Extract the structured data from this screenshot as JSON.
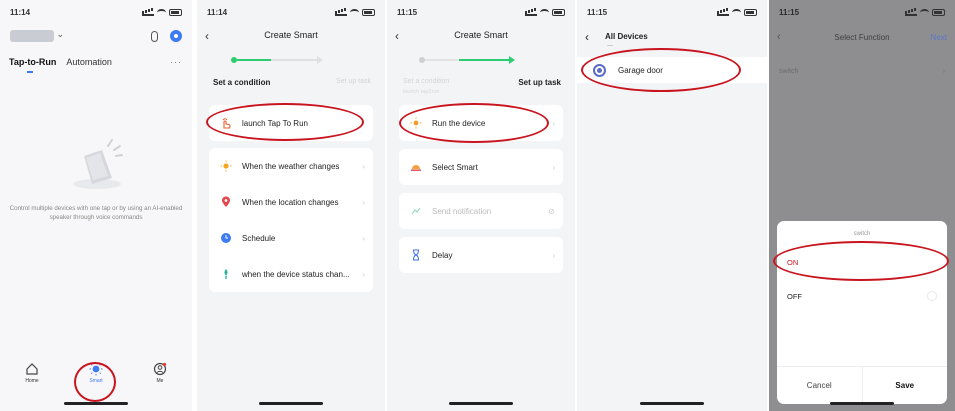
{
  "colors": {
    "accent": "#3d7bf2",
    "annotation": "#c8141e",
    "on_selected": "#c8141e"
  },
  "screens": [
    {
      "id": "home",
      "status_time": "11:14",
      "tabs": [
        "Tap-to-Run",
        "Automation"
      ],
      "more": "···",
      "empty_text": "Control multiple devices with one tap or by using an AI-enabled speaker through voice commands",
      "tabbar": [
        {
          "label": "Home",
          "icon": "home-icon"
        },
        {
          "label": "Smart",
          "icon": "smart-sun-icon"
        },
        {
          "label": "Me",
          "icon": "me-icon"
        }
      ]
    },
    {
      "id": "create-smart-condition",
      "status_time": "11:14",
      "title": "Create Smart",
      "step_labels": [
        "Set a condition",
        "Set up task"
      ],
      "items": [
        {
          "label": "launch Tap To Run",
          "icon": "hand-tap-icon"
        },
        {
          "label": "When the weather changes",
          "icon": "weather-sun-icon"
        },
        {
          "label": "When the location changes",
          "icon": "location-pin-icon"
        },
        {
          "label": "Schedule",
          "icon": "clock-icon"
        },
        {
          "label": "when the device status chan...",
          "icon": "device-icon"
        }
      ]
    },
    {
      "id": "create-smart-task",
      "status_time": "11:15",
      "title": "Create Smart",
      "step_labels": [
        "Set a condition",
        "Set up task"
      ],
      "step_sub": "launch tap2run",
      "items": [
        {
          "label": "Run the device",
          "icon": "device-sun-icon"
        },
        {
          "label": "Select Smart",
          "icon": "smart-scene-icon"
        },
        {
          "label": "Send notification",
          "icon": "notification-icon"
        },
        {
          "label": "Delay",
          "icon": "hourglass-icon"
        }
      ]
    },
    {
      "id": "all-devices",
      "status_time": "11:15",
      "title": "All Devices",
      "devices": [
        {
          "label": "Garage door",
          "icon": "garage-door-icon"
        }
      ]
    },
    {
      "id": "select-function",
      "status_time": "11:15",
      "title": "Select Function",
      "next": "Next",
      "row": "switch",
      "sheet": {
        "title": "switch",
        "options": [
          "ON",
          "OFF"
        ],
        "selected": "ON",
        "cancel": "Cancel",
        "save": "Save"
      }
    }
  ]
}
